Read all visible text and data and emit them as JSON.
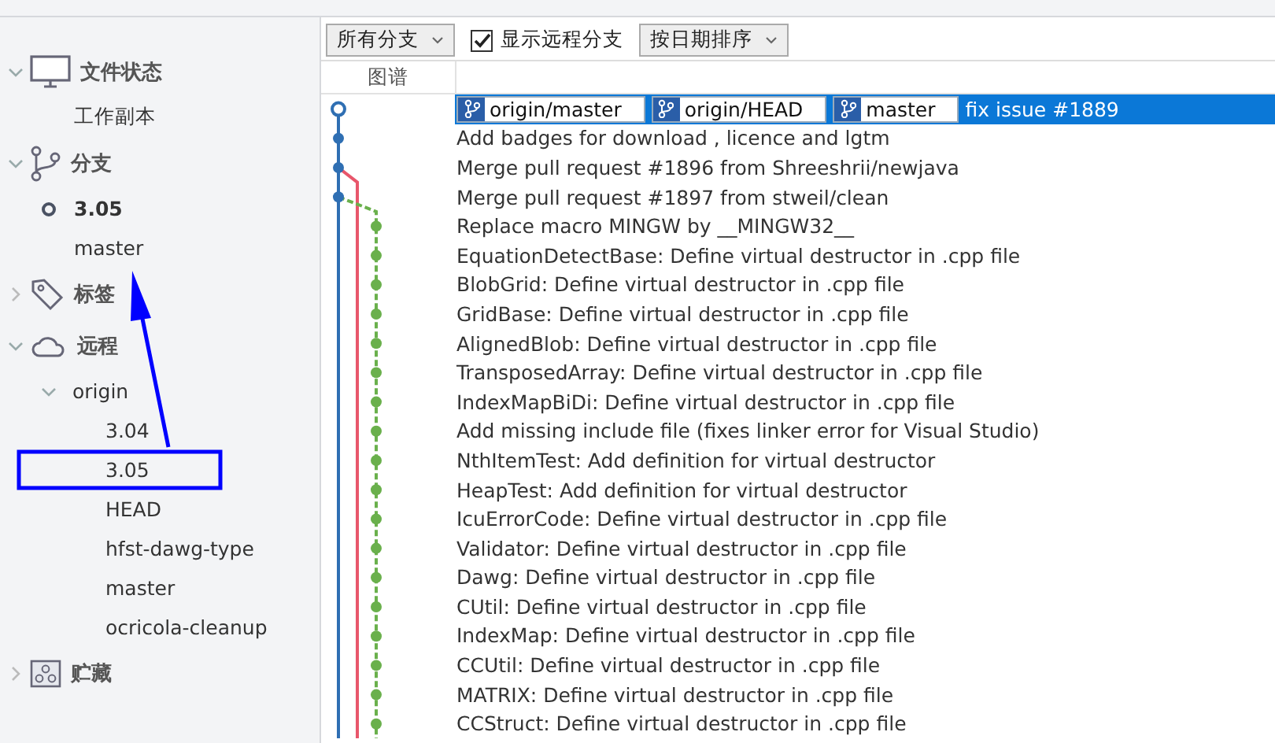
{
  "sidebar": {
    "sections": [
      {
        "label": "文件状态",
        "expanded": true,
        "children": [
          {
            "label": "工作副本",
            "current": false
          }
        ]
      },
      {
        "label": "分支",
        "expanded": true,
        "children": [
          {
            "label": "3.05",
            "current": true
          },
          {
            "label": "master",
            "current": false
          }
        ]
      },
      {
        "label": "标签",
        "expanded": false
      },
      {
        "label": "远程",
        "expanded": true,
        "children": [
          {
            "label": "origin",
            "expanded": true,
            "children": [
              {
                "label": "3.04"
              },
              {
                "label": "3.05",
                "highlighted": true
              },
              {
                "label": "HEAD"
              },
              {
                "label": "hfst-dawg-type"
              },
              {
                "label": "master"
              },
              {
                "label": "ocricola-cleanup"
              }
            ]
          }
        ]
      },
      {
        "label": "贮藏",
        "expanded": false
      }
    ]
  },
  "toolbar": {
    "branch_filter": "所有分支",
    "show_remote": {
      "label": "显示远程分支",
      "checked": true
    },
    "sort": "按日期排序"
  },
  "graph_header": "图谱",
  "commits": [
    {
      "refs": [
        "origin/master",
        "origin/HEAD",
        "master"
      ],
      "message": "fix issue #1889",
      "selected": true,
      "kind": "main",
      "color": "#2f6fb3"
    },
    {
      "message": "Add badges for download , licence and lgtm",
      "selected": false,
      "kind": "main",
      "color": "#2f6fb3"
    },
    {
      "message": "Merge pull request #1896 from Shreeshrii/newjava",
      "selected": false,
      "kind": "main",
      "color": "#2f6fb3"
    },
    {
      "message": "Merge pull request #1897 from stweil/clean",
      "selected": false,
      "kind": "main",
      "color": "#2f6fb3"
    },
    {
      "message": "Replace macro MINGW by __MINGW32__",
      "selected": false,
      "kind": "side",
      "color": "#6ab04c"
    },
    {
      "message": "EquationDetectBase: Define virtual destructor in .cpp file",
      "selected": false,
      "kind": "side",
      "color": "#6ab04c"
    },
    {
      "message": "BlobGrid: Define virtual destructor in .cpp file",
      "selected": false,
      "kind": "side",
      "color": "#6ab04c"
    },
    {
      "message": "GridBase: Define virtual destructor in .cpp file",
      "selected": false,
      "kind": "side",
      "color": "#6ab04c"
    },
    {
      "message": "AlignedBlob: Define virtual destructor in .cpp file",
      "selected": false,
      "kind": "side",
      "color": "#6ab04c"
    },
    {
      "message": "TransposedArray: Define virtual destructor in .cpp file",
      "selected": false,
      "kind": "side",
      "color": "#6ab04c"
    },
    {
      "message": "IndexMapBiDi: Define virtual destructor in .cpp file",
      "selected": false,
      "kind": "side",
      "color": "#6ab04c"
    },
    {
      "message": "Add missing include file (fixes linker error for Visual Studio)",
      "selected": false,
      "kind": "side",
      "color": "#6ab04c"
    },
    {
      "message": "NthItemTest: Add definition for virtual destructor",
      "selected": false,
      "kind": "side",
      "color": "#6ab04c"
    },
    {
      "message": "HeapTest: Add definition for virtual destructor",
      "selected": false,
      "kind": "side",
      "color": "#6ab04c"
    },
    {
      "message": "IcuErrorCode: Define virtual destructor in .cpp file",
      "selected": false,
      "kind": "side",
      "color": "#6ab04c"
    },
    {
      "message": "Validator: Define virtual destructor in .cpp file",
      "selected": false,
      "kind": "side",
      "color": "#6ab04c"
    },
    {
      "message": "Dawg: Define virtual destructor in .cpp file",
      "selected": false,
      "kind": "side",
      "color": "#6ab04c"
    },
    {
      "message": "CUtil: Define virtual destructor in .cpp file",
      "selected": false,
      "kind": "side",
      "color": "#6ab04c"
    },
    {
      "message": "IndexMap: Define virtual destructor in .cpp file",
      "selected": false,
      "kind": "side",
      "color": "#6ab04c"
    },
    {
      "message": "CCUtil: Define virtual destructor in .cpp file",
      "selected": false,
      "kind": "side",
      "color": "#6ab04c"
    },
    {
      "message": "MATRIX: Define virtual destructor in .cpp file",
      "selected": false,
      "kind": "side",
      "color": "#6ab04c"
    },
    {
      "message": "CCStruct: Define virtual destructor in .cpp file",
      "selected": false,
      "kind": "side",
      "color": "#6ab04c"
    }
  ]
}
